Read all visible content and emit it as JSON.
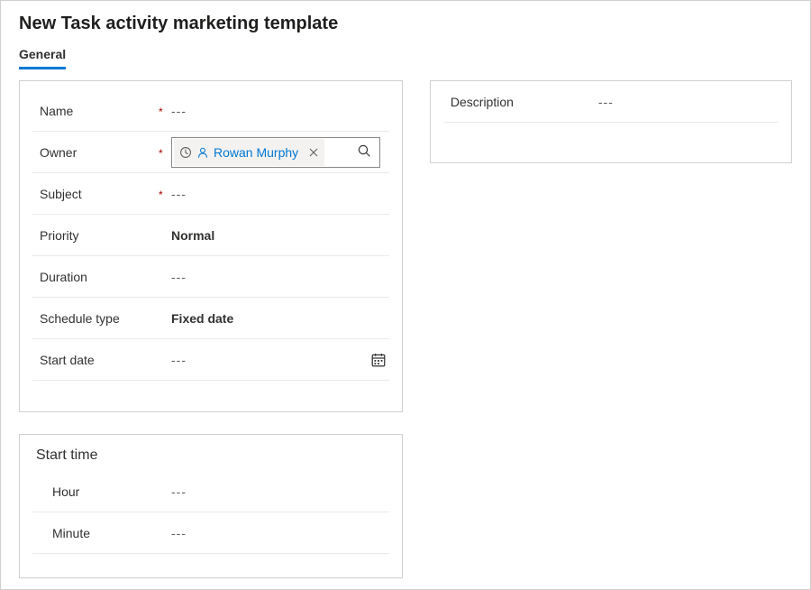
{
  "header": {
    "title": "New Task activity marketing template"
  },
  "tabs": [
    {
      "label": "General",
      "active": true
    }
  ],
  "general": {
    "name": {
      "label": "Name",
      "required": true,
      "value": "---",
      "bold": false
    },
    "owner": {
      "label": "Owner",
      "required": true,
      "chip_name": "Rowan Murphy"
    },
    "subject": {
      "label": "Subject",
      "required": true,
      "value": "---",
      "bold": false
    },
    "priority": {
      "label": "Priority",
      "required": false,
      "value": "Normal",
      "bold": true
    },
    "duration": {
      "label": "Duration",
      "required": false,
      "value": "---",
      "bold": false
    },
    "schedule_type": {
      "label": "Schedule type",
      "required": false,
      "value": "Fixed date",
      "bold": true
    },
    "start_date": {
      "label": "Start date",
      "required": false,
      "value": "---",
      "bold": false
    }
  },
  "start_time": {
    "title": "Start time",
    "hour": {
      "label": "Hour",
      "value": "---"
    },
    "minute": {
      "label": "Minute",
      "value": "---"
    }
  },
  "right": {
    "description": {
      "label": "Description",
      "value": "---"
    }
  },
  "required_mark": "*"
}
